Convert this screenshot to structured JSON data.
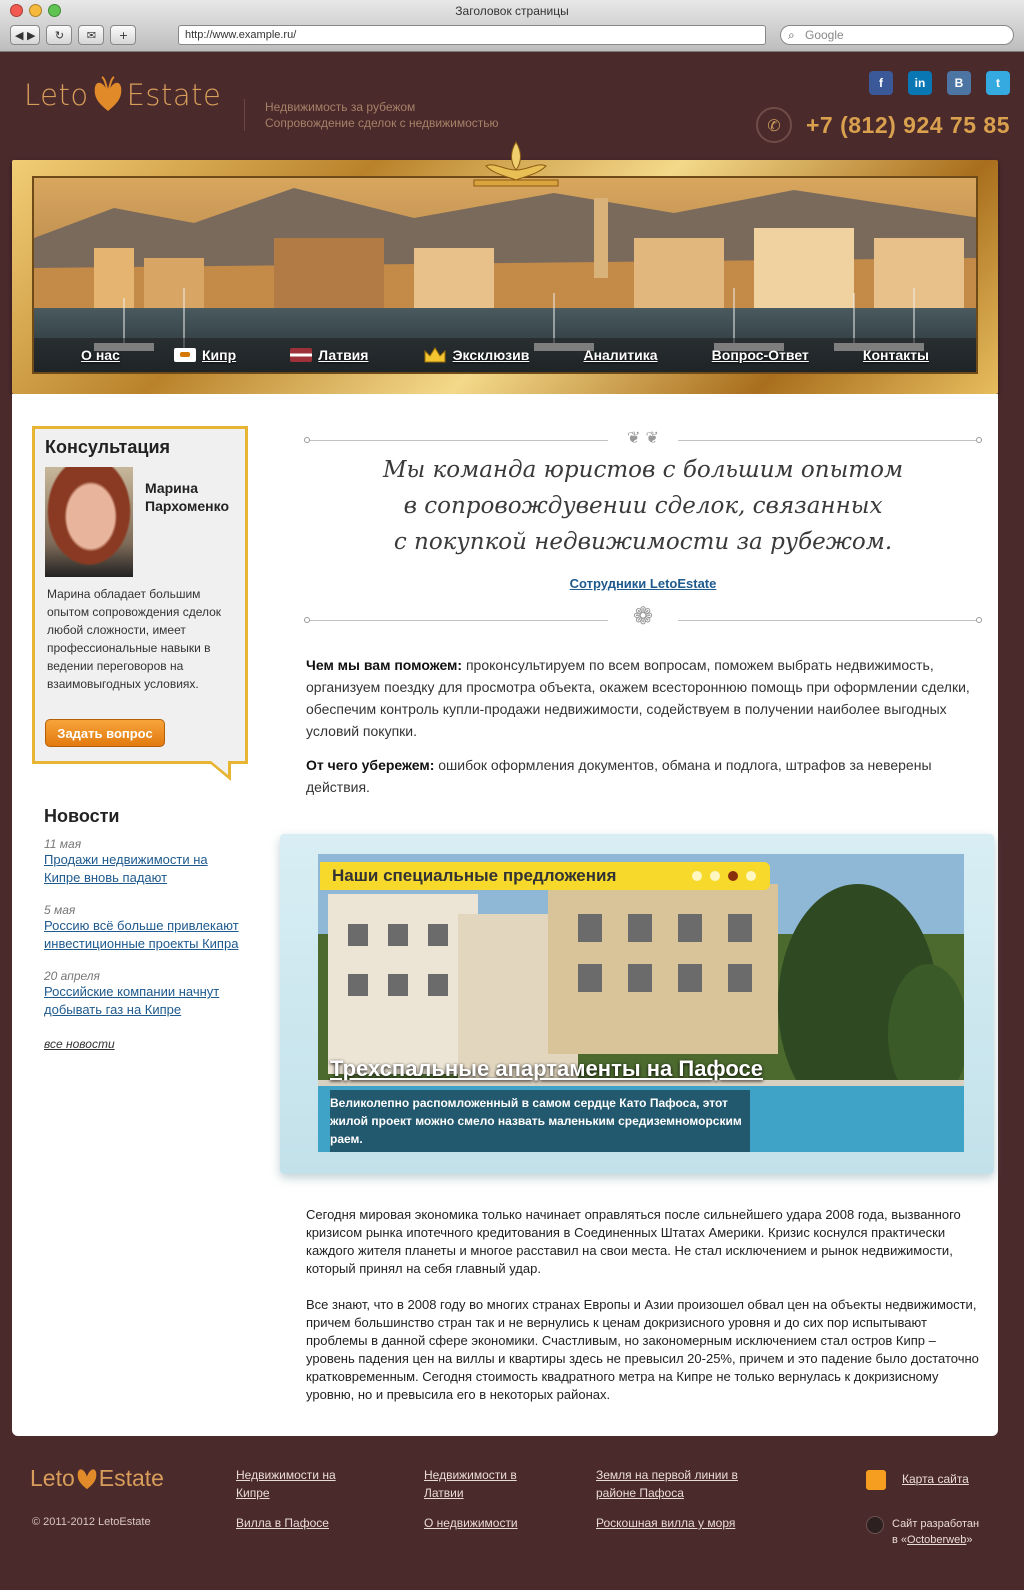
{
  "browser": {
    "title": "Заголовок страницы",
    "url": "http://www.example.ru/",
    "search_placeholder": "Google"
  },
  "header": {
    "logo_left": "Leto",
    "logo_right": "Estate",
    "tagline_1": "Недвижимость за рубежом",
    "tagline_2": "Сопровождение сделок с недвижимостью",
    "phone": "+7 (812) 924 75 85",
    "social": [
      {
        "name": "facebook",
        "label": "f"
      },
      {
        "name": "linkedin",
        "label": "in"
      },
      {
        "name": "vkontakte",
        "label": "B"
      },
      {
        "name": "twitter",
        "label": "t"
      }
    ]
  },
  "menu": [
    {
      "label": "О нас"
    },
    {
      "label": "Кипр",
      "icon": "cyprus-flag-icon"
    },
    {
      "label": "Латвия",
      "icon": "latvia-flag-icon"
    },
    {
      "label": "Эксклюзив",
      "icon": "crown-icon"
    },
    {
      "label": "Аналитика"
    },
    {
      "label": "Вопрос-Ответ"
    },
    {
      "label": "Контакты"
    }
  ],
  "consult": {
    "title": "Консультация",
    "name_first": "Марина",
    "name_last": "Пархоменко",
    "description": "Марина обладает большим опытом сопровождения сделок любой сложности, имеет профессиональные навыки в ведении переговоров на взаимовыгодных условиях.",
    "button": "Задать вопрос"
  },
  "news": {
    "title": "Новости",
    "items": [
      {
        "date": "11 мая",
        "text": "Продажи недвижимости на Кипре вновь падают"
      },
      {
        "date": "5 мая",
        "text": "Россию всё больше привлекают инвестиционные проекты Кипра"
      },
      {
        "date": "20 апреля",
        "text": "Российские компании начнут добывать газ на Кипре"
      }
    ],
    "all_link": "все новости"
  },
  "intro": {
    "quote_1": "Мы команда юристов с большим опытом",
    "quote_2": "в сопровождувении сделок, связанных",
    "quote_3": "с покупкой недвижимости за рубежом.",
    "staff_link": "Сотрудники LetoEstate"
  },
  "help": {
    "label_1": "Чем мы вам поможем:",
    "text_1": " проконсультируем по всем вопросам, поможем выбрать недвижимость, организуем поездку для просмотра объекта, окажем всестороннюю помощь при оформлении сделки, обеспечим контроль купли-продажи недвижимости, содействуем в получении наиболее выгодных условий покупки.",
    "label_2": "От чего убережем:",
    "text_2": " ошибок оформления документов, обмана и подлога, штрафов за неверены действия."
  },
  "offers": {
    "title": "Наши специальные предложения",
    "active_dot": 3,
    "item_title": "Трехспальные апартаменты на Пафосе",
    "item_desc": "Великолепно распомложенный в самом сердце Като Пафоса, этот жилой проект можно смело назвать маленьким средиземноморским раем."
  },
  "article": {
    "p1": "Сегодня мировая экономика только начинает оправляться после сильнейшего удара 2008 года, вызванного кризисом рынка ипотечного кредитования в Соединенных Штатах Америки. Кризис коснулся практически каждого жителя планеты и многое расставил на свои места. Не стал исключением и рынок недвижимости, который принял на себя главный удар.",
    "p2": "Все знают, что в 2008 году во многих странах Европы и Азии произошел обвал цен на объекты недвижимости, причем большинство стран так и не вернулись к ценам докризисного уровня и до сих пор испытывают проблемы в данной сфере экономики. Счастливым, но закономерным исключением стал остров Кипр – уровень падения цен на виллы и квартиры здесь не превысил 20-25%, причем и это падение было достаточно кратковременным. Сегодня стоимость квадратного метра на Кипре не только вернулась к докризисному уровню, но и превысила его в некоторых районах."
  },
  "footer": {
    "copyright": "© 2011-2012 LetoEstate",
    "col1": [
      "Недвижимости на Кипре",
      "Вилла в Пафосе"
    ],
    "col2": [
      "Недвижимости в Латвии",
      "О недвижимости"
    ],
    "col3": [
      "Земля на первой линии в районе Пафоса",
      "Роскошная  вилла у моря"
    ],
    "sitemap": "Карта сайта",
    "dev_text": "Сайт разработан",
    "dev_prefix": "в «",
    "dev_link": "Octoberweb",
    "dev_suffix": "»"
  },
  "colors": {
    "background": "#4b2a2c",
    "gold": "#d89d5a",
    "link": "#1e5a8e",
    "offer_strip": "#f6d92b",
    "button": "#e27a0f"
  }
}
